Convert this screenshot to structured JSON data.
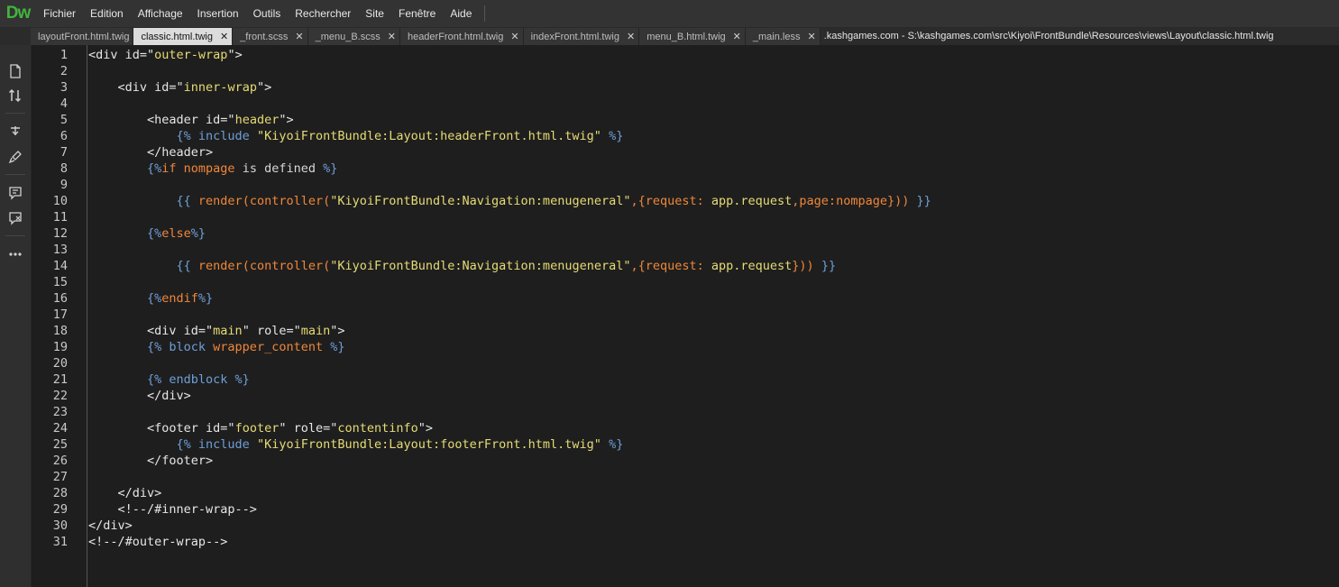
{
  "app": {
    "logo": "Dw",
    "menu": [
      "Fichier",
      "Edition",
      "Affichage",
      "Insertion",
      "Outils",
      "Rechercher",
      "Site",
      "Fenêtre",
      "Aide"
    ]
  },
  "tabs": [
    {
      "label": "layoutFront.html.twig",
      "active": false
    },
    {
      "label": "classic.html.twig",
      "active": true
    },
    {
      "label": "_front.scss",
      "active": false
    },
    {
      "label": "_menu_B.scss",
      "active": false
    },
    {
      "label": "headerFront.html.twig",
      "active": false
    },
    {
      "label": "indexFront.html.twig",
      "active": false
    },
    {
      "label": "menu_B.html.twig",
      "active": false
    },
    {
      "label": "_main.less",
      "active": false
    }
  ],
  "tab_close_glyph": "✕",
  "file_path": ".kashgames.com - S:\\kashgames.com\\src\\Kiyoi\\FrontBundle\\Resources\\views\\Layout\\classic.html.twig",
  "toolbar_icons": [
    "file-icon",
    "sort-arrows-icon",
    "wand-icon",
    "brush-icon",
    "comment-icon",
    "comment-remove-icon",
    "more-icon"
  ],
  "line_numbers": [
    "1",
    "2",
    "3",
    "4",
    "5",
    "6",
    "7",
    "8",
    "9",
    "10",
    "11",
    "12",
    "13",
    "14",
    "15",
    "16",
    "17",
    "18",
    "19",
    "20",
    "21",
    "22",
    "23",
    "24",
    "25",
    "26",
    "27",
    "28",
    "29",
    "30",
    "31"
  ],
  "code_lines": [
    [
      [
        "tag",
        "<div id=\""
      ],
      [
        "str",
        "outer-wrap"
      ],
      [
        "tag",
        "\">"
      ]
    ],
    [],
    [
      [
        "tag",
        "    <div id=\""
      ],
      [
        "str",
        "inner-wrap"
      ],
      [
        "tag",
        "\">"
      ]
    ],
    [],
    [
      [
        "tag",
        "        <header id=\""
      ],
      [
        "str",
        "header"
      ],
      [
        "tag",
        "\">"
      ]
    ],
    [
      [
        "twig",
        "            {% include "
      ],
      [
        "str",
        "\"KiyoiFrontBundle:Layout:headerFront.html.twig\""
      ],
      [
        "twig",
        " %}"
      ]
    ],
    [
      [
        "tag",
        "        </header>"
      ]
    ],
    [
      [
        "twig",
        "        {%"
      ],
      [
        "fn",
        "if nompage "
      ],
      [
        "kw",
        "is defined"
      ],
      [
        "twig",
        " %}"
      ]
    ],
    [],
    [
      [
        "twig",
        "            {{ "
      ],
      [
        "fn",
        "render(controller("
      ],
      [
        "str",
        "\"KiyoiFrontBundle:Navigation:menugeneral\""
      ],
      [
        "fn",
        ",{request: "
      ],
      [
        "str",
        "app.request"
      ],
      [
        "fn",
        ",page:nompage})) "
      ],
      [
        "twig",
        "}}"
      ]
    ],
    [],
    [
      [
        "twig",
        "        {%"
      ],
      [
        "fn",
        "else"
      ],
      [
        "twig",
        "%}"
      ]
    ],
    [],
    [
      [
        "twig",
        "            {{ "
      ],
      [
        "fn",
        "render(controller("
      ],
      [
        "str",
        "\"KiyoiFrontBundle:Navigation:menugeneral\""
      ],
      [
        "fn",
        ",{request: "
      ],
      [
        "str",
        "app.request"
      ],
      [
        "fn",
        "})) "
      ],
      [
        "twig",
        "}}"
      ]
    ],
    [],
    [
      [
        "twig",
        "        {%"
      ],
      [
        "fn",
        "endif"
      ],
      [
        "twig",
        "%}"
      ]
    ],
    [],
    [
      [
        "tag",
        "        <div id=\""
      ],
      [
        "str",
        "main"
      ],
      [
        "tag",
        "\" role=\""
      ],
      [
        "str",
        "main"
      ],
      [
        "tag",
        "\">"
      ]
    ],
    [
      [
        "twig",
        "        {% block "
      ],
      [
        "fn",
        "wrapper_content"
      ],
      [
        "twig",
        " %}"
      ]
    ],
    [],
    [
      [
        "twig",
        "        {% endblock %}"
      ]
    ],
    [
      [
        "tag",
        "        </div>"
      ]
    ],
    [],
    [
      [
        "tag",
        "        <footer id=\""
      ],
      [
        "str",
        "footer"
      ],
      [
        "tag",
        "\" role=\""
      ],
      [
        "str",
        "contentinfo"
      ],
      [
        "tag",
        "\">"
      ]
    ],
    [
      [
        "twig",
        "            {% include "
      ],
      [
        "str",
        "\"KiyoiFrontBundle:Layout:footerFront.html.twig\""
      ],
      [
        "twig",
        " %}"
      ]
    ],
    [
      [
        "tag",
        "        </footer>"
      ]
    ],
    [],
    [
      [
        "tag",
        "    </div>"
      ]
    ],
    [
      [
        "comment",
        "    <!--/#inner-wrap-->"
      ]
    ],
    [
      [
        "tag",
        "</div>"
      ]
    ],
    [
      [
        "comment",
        "<!--/#outer-wrap-->"
      ]
    ]
  ]
}
